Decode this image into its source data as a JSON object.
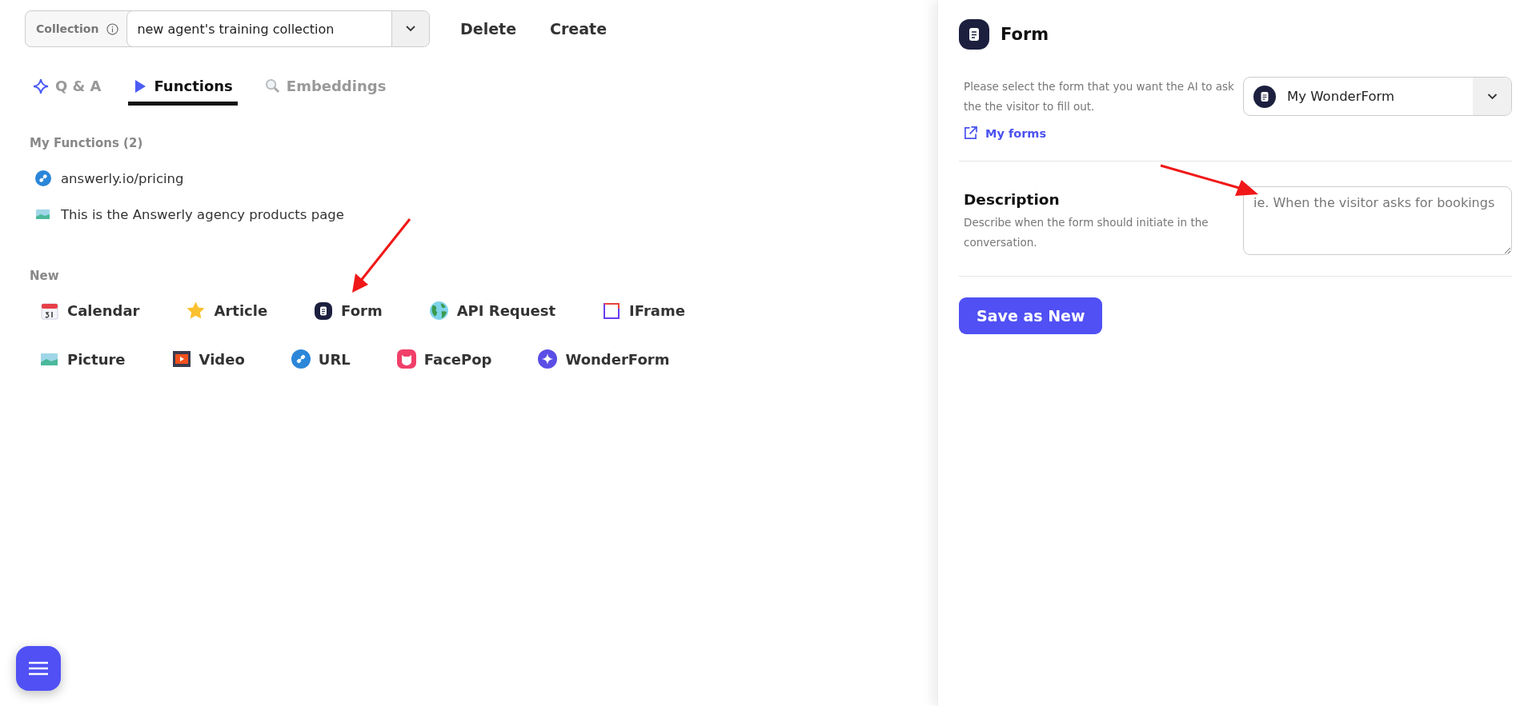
{
  "collection": {
    "label": "Collection",
    "value": "new agent's training collection"
  },
  "actions": [
    "Delete",
    "Create"
  ],
  "tabs": [
    {
      "label": "Q & A",
      "kind": "sparkle",
      "selected": false
    },
    {
      "label": "Functions",
      "kind": "play",
      "selected": true
    },
    {
      "label": "Embeddings",
      "kind": "search",
      "selected": false
    }
  ],
  "my_functions": {
    "heading": "My Functions (2)",
    "items": [
      {
        "label": "answerly.io/pricing",
        "kind": "link"
      },
      {
        "label": "This is the Answerly agency products page",
        "kind": "picture"
      }
    ]
  },
  "new": {
    "heading": "New",
    "rows": [
      [
        {
          "label": "Calendar",
          "kind": "calendar"
        },
        {
          "label": "Article",
          "kind": "star"
        },
        {
          "label": "Form",
          "kind": "form"
        },
        {
          "label": "API Request",
          "kind": "globe"
        },
        {
          "label": "IFrame",
          "kind": "iframe"
        }
      ],
      [
        {
          "label": "Picture",
          "kind": "picture"
        },
        {
          "label": "Video",
          "kind": "video"
        },
        {
          "label": "URL",
          "kind": "link"
        },
        {
          "label": "FacePop",
          "kind": "facepop"
        },
        {
          "label": "WonderForm",
          "kind": "sparkle"
        }
      ]
    ]
  },
  "panel": {
    "title": "Form",
    "select_help": "Please select the form that you want the AI to ask the the visitor to fill out.",
    "select_value": "My WonderForm",
    "link": "My forms",
    "description_title": "Description",
    "description_help": "Describe when the form should initiate in the conversation.",
    "description_placeholder": "ie. When the visitor asks for bookings",
    "save": "Save as New"
  }
}
